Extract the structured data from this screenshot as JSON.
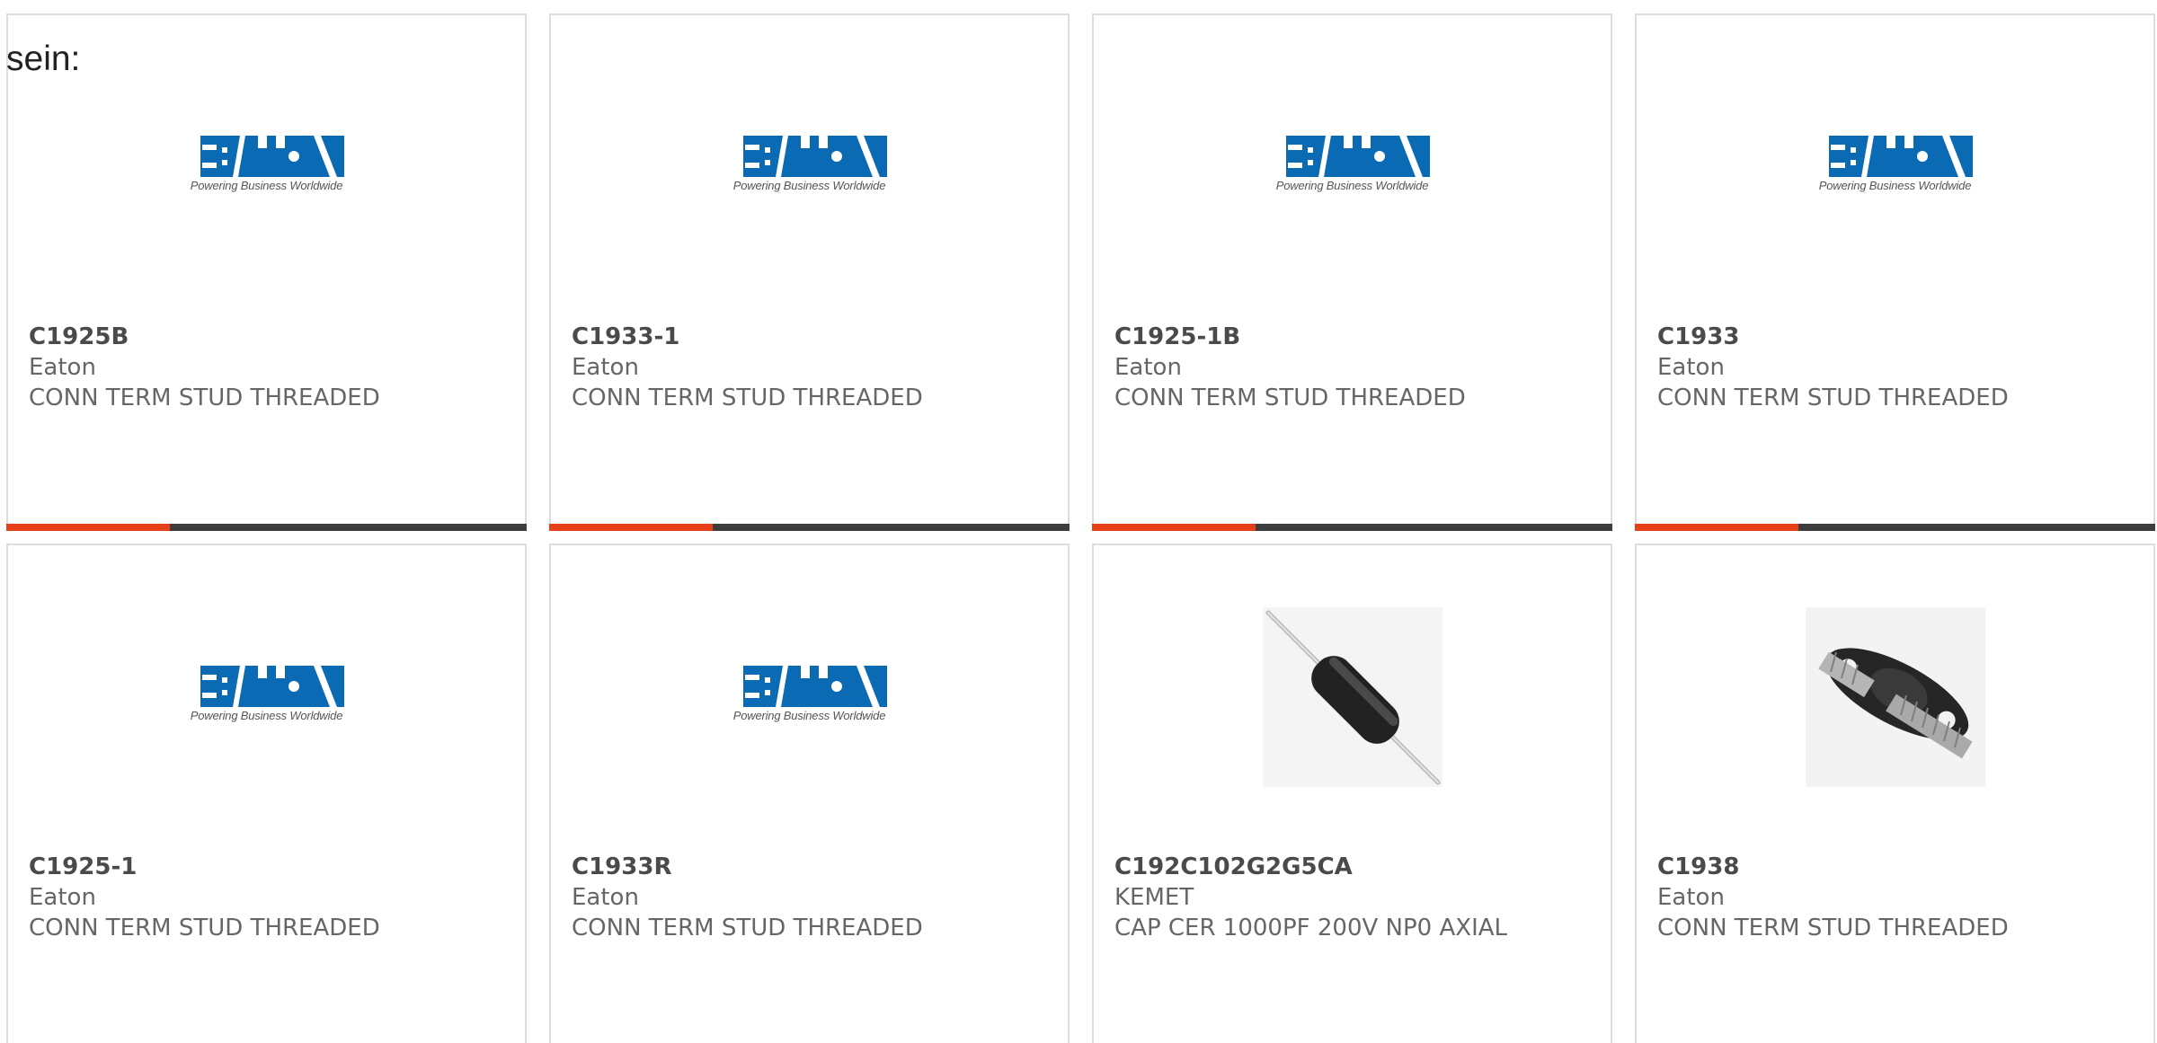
{
  "intro_text": "sein:",
  "colors": {
    "accent": "#e84018",
    "bar": "#3d3d3d",
    "eaton_blue": "#0a6ab4"
  },
  "products": [
    {
      "part_no": "C1925B",
      "manufacturer": "Eaton",
      "description": "CONN TERM STUD THREADED",
      "image": "eaton-logo",
      "logo_text": "E:T·N",
      "logo_tagline": "Powering Business Worldwide"
    },
    {
      "part_no": "C1933-1",
      "manufacturer": "Eaton",
      "description": "CONN TERM STUD THREADED",
      "image": "eaton-logo",
      "logo_text": "E:T·N",
      "logo_tagline": "Powering Business Worldwide"
    },
    {
      "part_no": "C1925-1B",
      "manufacturer": "Eaton",
      "description": "CONN TERM STUD THREADED",
      "image": "eaton-logo",
      "logo_text": "E:T·N",
      "logo_tagline": "Powering Business Worldwide"
    },
    {
      "part_no": "C1933",
      "manufacturer": "Eaton",
      "description": "CONN TERM STUD THREADED",
      "image": "eaton-logo",
      "logo_text": "E:T·N",
      "logo_tagline": "Powering Business Worldwide"
    },
    {
      "part_no": "C1925-1",
      "manufacturer": "Eaton",
      "description": "CONN TERM STUD THREADED",
      "image": "eaton-logo",
      "logo_text": "E:T·N",
      "logo_tagline": "Powering Business Worldwide"
    },
    {
      "part_no": "C1933R",
      "manufacturer": "Eaton",
      "description": "CONN TERM STUD THREADED",
      "image": "eaton-logo",
      "logo_text": "E:T·N",
      "logo_tagline": "Powering Business Worldwide"
    },
    {
      "part_no": "C192C102G2G5CA",
      "manufacturer": "KEMET",
      "description": "CAP CER 1000PF 200V NP0 AXIAL",
      "image": "axial-capacitor-photo"
    },
    {
      "part_no": "C1938",
      "manufacturer": "Eaton",
      "description": "CONN TERM STUD THREADED",
      "image": "terminal-stud-photo"
    }
  ]
}
